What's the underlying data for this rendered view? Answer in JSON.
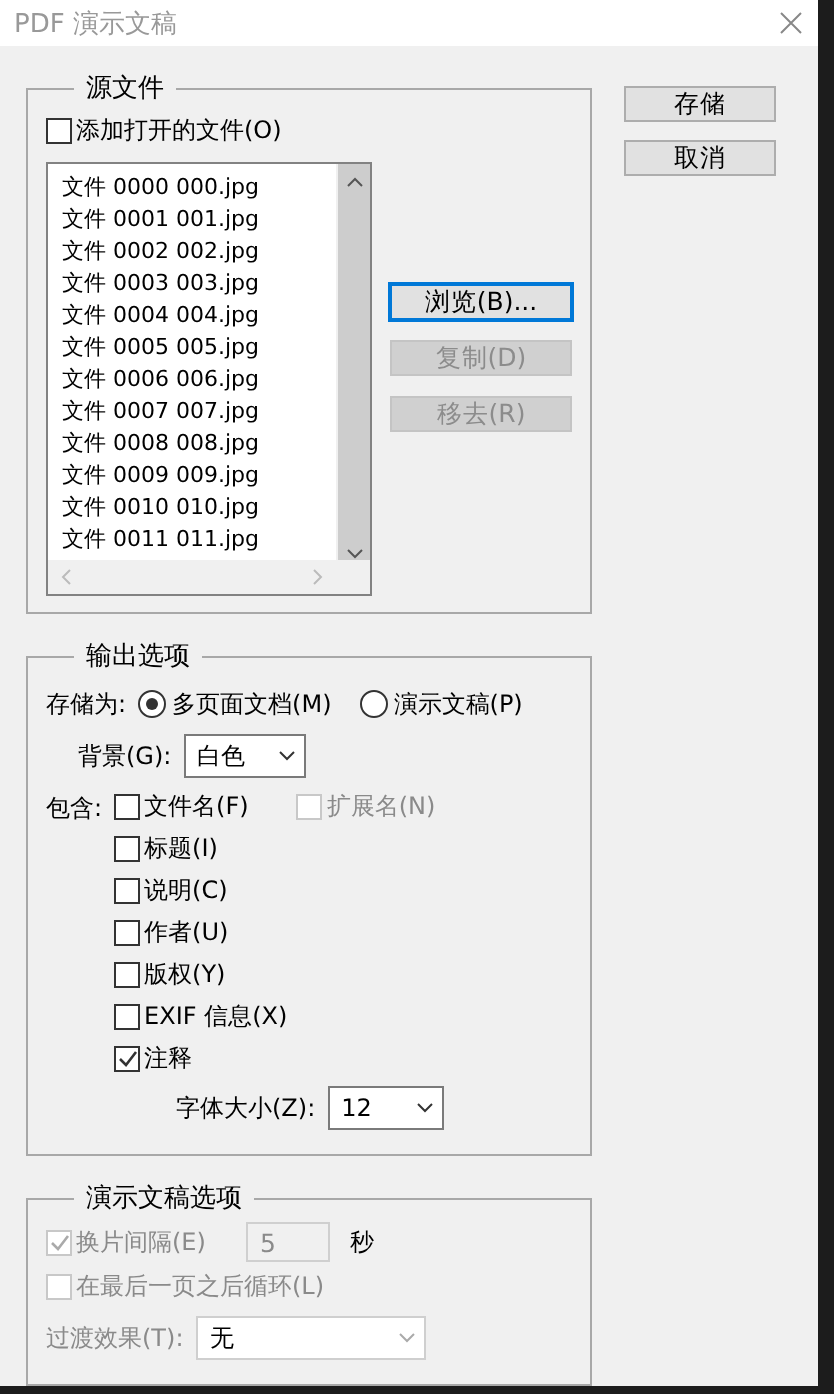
{
  "window": {
    "title": "PDF 演示文稿"
  },
  "source": {
    "title": "源文件",
    "add_open": {
      "label": "添加打开的文件(O)",
      "checked": false
    },
    "files": [
      {
        "label": "文件",
        "index": "0000",
        "file": "000.jpg"
      },
      {
        "label": "文件",
        "index": "0001",
        "file": "001.jpg"
      },
      {
        "label": "文件",
        "index": "0002",
        "file": "002.jpg"
      },
      {
        "label": "文件",
        "index": "0003",
        "file": "003.jpg"
      },
      {
        "label": "文件",
        "index": "0004",
        "file": "004.jpg"
      },
      {
        "label": "文件",
        "index": "0005",
        "file": "005.jpg"
      },
      {
        "label": "文件",
        "index": "0006",
        "file": "006.jpg"
      },
      {
        "label": "文件",
        "index": "0007",
        "file": "007.jpg"
      },
      {
        "label": "文件",
        "index": "0008",
        "file": "008.jpg"
      },
      {
        "label": "文件",
        "index": "0009",
        "file": "009.jpg"
      },
      {
        "label": "文件",
        "index": "0010",
        "file": "010.jpg"
      },
      {
        "label": "文件",
        "index": "0011",
        "file": "011.jpg"
      }
    ],
    "buttons": [
      {
        "label": "浏览(B)...",
        "disabled": false,
        "focused": true
      },
      {
        "label": "复制(D)",
        "disabled": true,
        "focused": false
      },
      {
        "label": "移去(R)",
        "disabled": true,
        "focused": false
      }
    ]
  },
  "side_buttons": [
    "存储",
    "取消"
  ],
  "output": {
    "title": "输出选项",
    "save_as_label": "存储为:",
    "save_as": [
      {
        "label": "多页面文档(M)",
        "selected": true
      },
      {
        "label": "演示文稿(P)",
        "selected": false
      }
    ],
    "background_label": "背景(G):",
    "background": "白色",
    "include_label": "包含:",
    "include": [
      {
        "label": "文件名(F)",
        "checked": false,
        "disabled": false,
        "extra": {
          "label": "扩展名(N)",
          "checked": false,
          "disabled": true
        }
      },
      {
        "label": "标题(I)",
        "checked": false,
        "disabled": false
      },
      {
        "label": "说明(C)",
        "checked": false,
        "disabled": false
      },
      {
        "label": "作者(U)",
        "checked": false,
        "disabled": false
      },
      {
        "label": "版权(Y)",
        "checked": false,
        "disabled": false
      },
      {
        "label": "EXIF 信息(X)",
        "checked": false,
        "disabled": false
      },
      {
        "label": "注释",
        "checked": true,
        "disabled": false
      }
    ],
    "font_size_label": "字体大小(Z):",
    "font_size": "12"
  },
  "presentation": {
    "title": "演示文稿选项",
    "advance": {
      "label": "换片间隔(E)",
      "checked": true,
      "disabled": true,
      "value": "5",
      "unit": "秒"
    },
    "loop": {
      "label": "在最后一页之后循环(L)",
      "checked": false,
      "disabled": true
    },
    "transition_label": "过渡效果(T):",
    "transition": "无",
    "transition_disabled": true
  }
}
